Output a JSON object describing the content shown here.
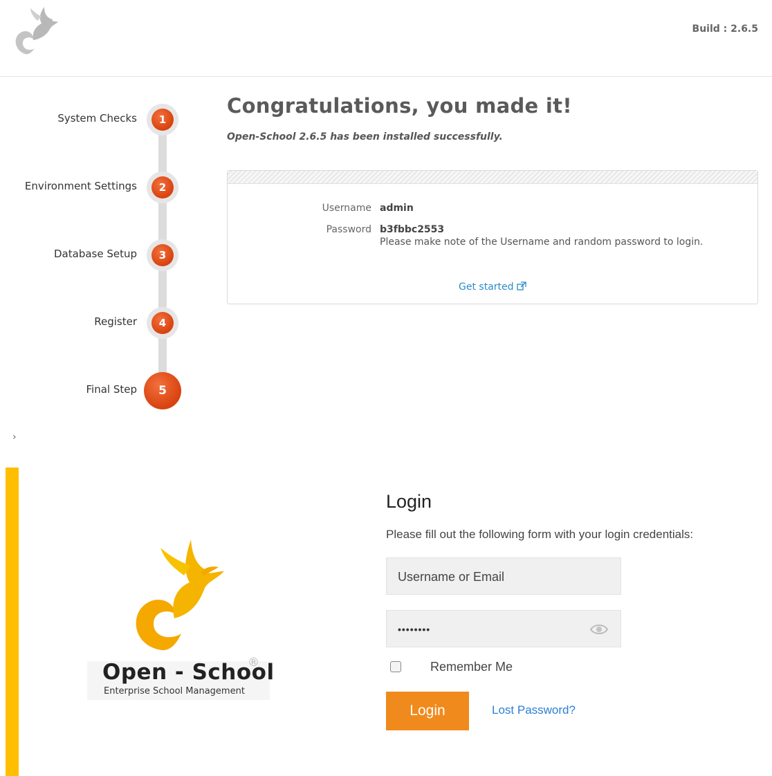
{
  "header": {
    "build_label": "Build : 2.6.5"
  },
  "steps": [
    {
      "number": "1",
      "label": "System Checks"
    },
    {
      "number": "2",
      "label": "Environment Settings"
    },
    {
      "number": "3",
      "label": "Database Setup"
    },
    {
      "number": "4",
      "label": "Register"
    },
    {
      "number": "5",
      "label": "Final Step"
    }
  ],
  "active_step": 5,
  "main": {
    "title": "Congratulations, you made it!",
    "subtitle": "Open-School 2.6.5 has been installed successfully.",
    "credentials": {
      "username_label": "Username",
      "username_value": "admin",
      "password_label": "Password",
      "password_value": "b3fbbc2553",
      "note": "Please make note of the Username and random password to login."
    },
    "get_started": "Get started",
    "get_started_icon": "external-link-icon"
  },
  "chevron": "›",
  "login": {
    "brand_name": "Open - School",
    "brand_reg": "®",
    "brand_tagline": "Enterprise School Management",
    "title": "Login",
    "subtitle": "Please fill out the following form with your login credentials:",
    "username_placeholder": "Username or Email",
    "password_value": "••••••••",
    "remember_label": "Remember Me",
    "login_button": "Login",
    "lost_password": "Lost Password?"
  },
  "colors": {
    "step_orange": "#d8420f",
    "accent_yellow": "#ffbe00",
    "brand_orange": "#f5a800",
    "login_button": "#f08a1c",
    "link_blue": "#2a7fd4"
  }
}
